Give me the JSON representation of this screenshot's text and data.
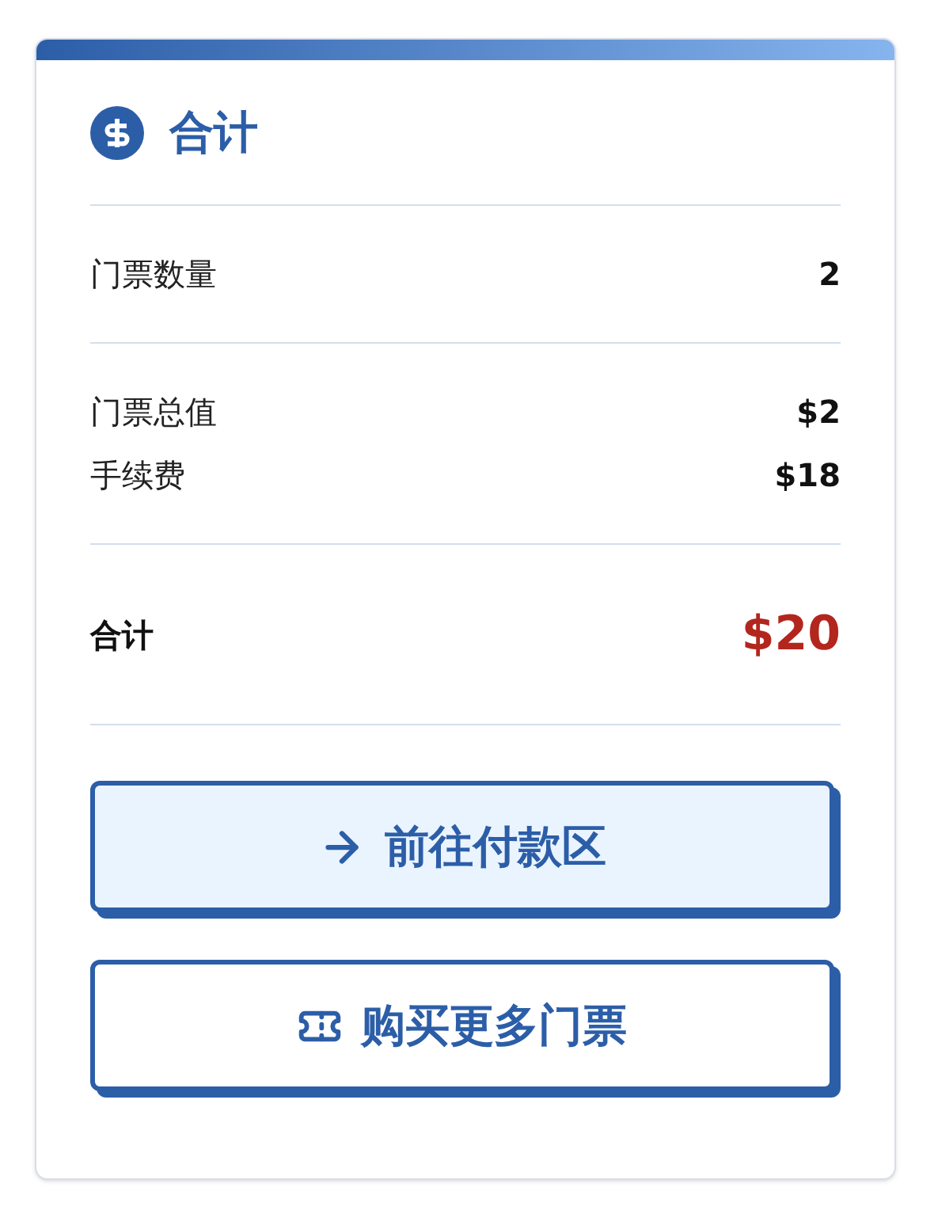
{
  "summary": {
    "title": "合计",
    "sections": [
      [
        {
          "label": "门票数量",
          "value": "2"
        }
      ],
      [
        {
          "label": "门票总值",
          "value": "$2"
        },
        {
          "label": "手续费",
          "value": "$18"
        }
      ]
    ],
    "total": {
      "label": "合计",
      "value": "$20"
    },
    "buttons": [
      {
        "kind": "checkout",
        "label": "前往付款区",
        "highlighted": true
      },
      {
        "kind": "more",
        "label": "购买更多门票",
        "highlighted": false
      }
    ]
  }
}
